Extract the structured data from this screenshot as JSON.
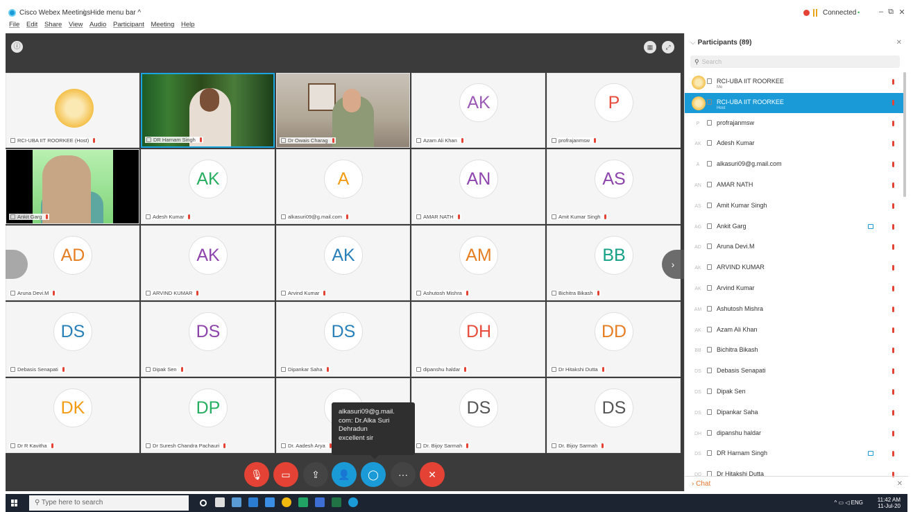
{
  "window": {
    "title": "Cisco Webex Meetings",
    "hide_menu": "Hide menu bar ^",
    "connection": "Connected",
    "connection_dot": "•"
  },
  "menu": [
    "File",
    "Edit",
    "Share",
    "View",
    "Audio",
    "Participant",
    "Meeting",
    "Help"
  ],
  "tiles": [
    {
      "label": "RCI-UBA IIT ROORKEE (Host)",
      "kind": "logo"
    },
    {
      "label": "DR Harnam Singh",
      "kind": "video1"
    },
    {
      "label": "Dr Owais Charag",
      "kind": "video2"
    },
    {
      "label": "Azam Ali Khan",
      "initials": "AK",
      "color": "#9b59b6"
    },
    {
      "label": "profrajanmsw",
      "initials": "P",
      "color": "#e74c3c"
    },
    {
      "label": "Ankit Garg",
      "kind": "video3"
    },
    {
      "label": "Adesh Kumar",
      "initials": "AK",
      "color": "#27ae60"
    },
    {
      "label": "alkasuri09@g.mail.com",
      "initials": "A",
      "color": "#f39c12"
    },
    {
      "label": "AMAR NATH",
      "initials": "AN",
      "color": "#8e44ad"
    },
    {
      "label": "Amit Kumar Singh",
      "initials": "AS",
      "color": "#8e44ad"
    },
    {
      "label": "Aruna Devi.M",
      "initials": "AD",
      "color": "#e67e22"
    },
    {
      "label": "ARVIND KUMAR",
      "initials": "AK",
      "color": "#8e44ad"
    },
    {
      "label": "Arvind Kumar",
      "initials": "AK",
      "color": "#2980b9"
    },
    {
      "label": "Ashutosh Mishra",
      "initials": "AM",
      "color": "#e67e22"
    },
    {
      "label": "Bichitra Bikash",
      "initials": "BB",
      "color": "#16a085"
    },
    {
      "label": "Debasis Senapati",
      "initials": "DS",
      "color": "#2980b9"
    },
    {
      "label": "Dipak Sen",
      "initials": "DS",
      "color": "#8e44ad"
    },
    {
      "label": "Dipankar Saha",
      "initials": "DS",
      "color": "#2980b9"
    },
    {
      "label": "dipanshu haldar",
      "initials": "DH",
      "color": "#e74c3c"
    },
    {
      "label": "Dr Hitakshi Dutta",
      "initials": "DD",
      "color": "#e67e22"
    },
    {
      "label": "Dr R Kavitha",
      "initials": "DK",
      "color": "#f39c12"
    },
    {
      "label": "Dr Suresh Chandra Pachauri",
      "initials": "DP",
      "color": "#27ae60"
    },
    {
      "label": "Dr. Aadesh Arya",
      "initials": "",
      "color": "#2980b9"
    },
    {
      "label": "Dr. Bijoy Sarmah",
      "initials": "DS",
      "color": "#555"
    },
    {
      "label": "Dr. Bijoy Sarmah",
      "initials": "DS",
      "color": "#555"
    }
  ],
  "tooltip": {
    "lines": [
      "alkasuri09@g.mail.",
      "com: Dr.Alka Suri",
      "Dehradun",
      "excellent sir"
    ]
  },
  "panel": {
    "title": "Participants (89)",
    "search_placeholder": "Search",
    "chat": "Chat",
    "participants": [
      {
        "name": "RCI-UBA IIT ROORKEE",
        "sub": "Me",
        "av": "logo"
      },
      {
        "name": "RCI-UBA IIT ROORKEE",
        "sub": "Host",
        "av": "logo",
        "selected": true
      },
      {
        "name": "profrajanmsw",
        "av": "P"
      },
      {
        "name": "Adesh Kumar",
        "av": "AK"
      },
      {
        "name": "alkasuri09@g.mail.com",
        "av": "A"
      },
      {
        "name": "AMAR NATH",
        "av": "AN"
      },
      {
        "name": "Amit Kumar Singh",
        "av": "AS"
      },
      {
        "name": "Ankit Garg",
        "av": "AG",
        "cam": true
      },
      {
        "name": "Aruna Devi.M",
        "av": "AD"
      },
      {
        "name": "ARVIND KUMAR",
        "av": "AK"
      },
      {
        "name": "Arvind Kumar",
        "av": "AK"
      },
      {
        "name": "Ashutosh Mishra",
        "av": "AM"
      },
      {
        "name": "Azam Ali Khan",
        "av": "AK"
      },
      {
        "name": "Bichitra Bikash",
        "av": "BB"
      },
      {
        "name": "Debasis Senapati",
        "av": "DS"
      },
      {
        "name": "Dipak Sen",
        "av": "DS"
      },
      {
        "name": "Dipankar Saha",
        "av": "DS"
      },
      {
        "name": "dipanshu haldar",
        "av": "DH"
      },
      {
        "name": "DR Harnam Singh",
        "av": "DS",
        "cam": true
      },
      {
        "name": "Dr Hitakshi Dutta",
        "av": "DD"
      }
    ]
  },
  "taskbar": {
    "search_placeholder": "Type here to search",
    "lang": "ENG",
    "time": "11:42 AM",
    "date": "11-Jul-20"
  }
}
